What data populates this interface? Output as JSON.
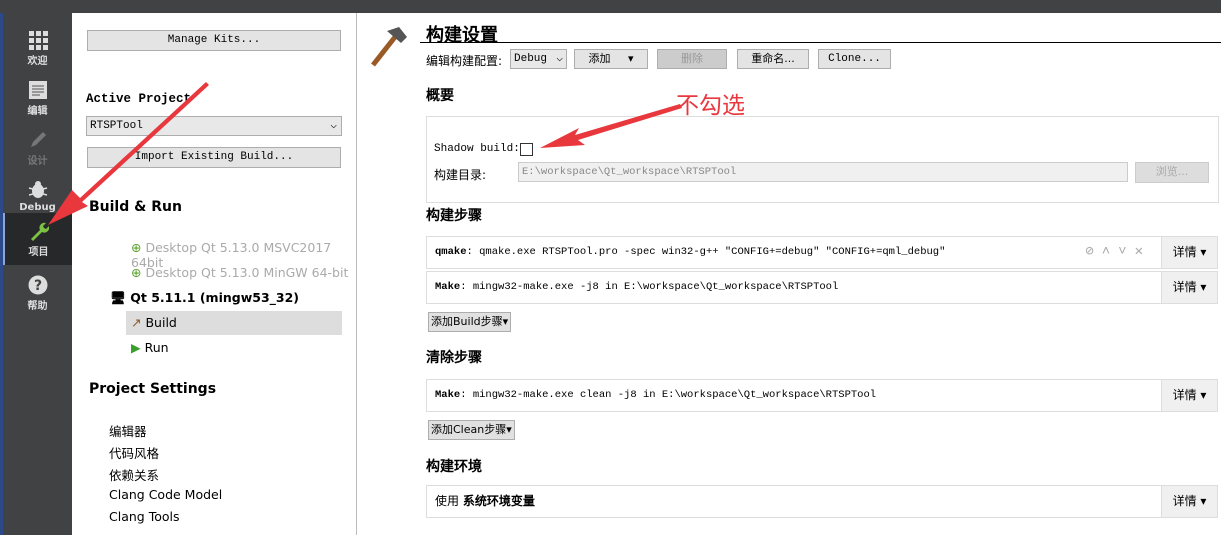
{
  "nav": [
    {
      "label": "欢迎",
      "icon": "grid-icon"
    },
    {
      "label": "编辑",
      "icon": "document-icon"
    },
    {
      "label": "设计",
      "icon": "pencil-icon"
    },
    {
      "label": "Debug",
      "icon": "bug-icon"
    },
    {
      "label": "项目",
      "icon": "wrench-icon",
      "active": true
    },
    {
      "label": "帮助",
      "icon": "help-icon"
    }
  ],
  "left": {
    "manage_kits": "Manage Kits...",
    "active_project_label": "Active Project",
    "active_project": "RTSPTool",
    "import_build": "Import Existing Build...",
    "build_run": "Build & Run",
    "kits": [
      "Desktop Qt 5.13.0 MSVC2017 64bit",
      "Desktop Qt 5.13.0 MinGW 64-bit"
    ],
    "active_kit": "Qt 5.11.1 (mingw53_32)",
    "build": "Build",
    "run": "Run",
    "project_settings": "Project Settings",
    "settings": [
      "编辑器",
      "代码风格",
      "依赖关系",
      "Clang Code Model",
      "Clang Tools"
    ]
  },
  "right": {
    "title": "构建设置",
    "edit_config_label": "编辑构建配置:",
    "config": "Debug",
    "add": "添加",
    "remove": "删除",
    "rename": "重命名...",
    "clone": "Clone...",
    "overview": "概要",
    "shadow_build_label": "Shadow build:",
    "shadow_build_checked": false,
    "build_dir_label": "构建目录:",
    "build_dir": "E:\\workspace\\Qt_workspace\\RTSPTool",
    "browse": "浏览...",
    "build_steps": "构建步骤",
    "qmake_label": "qmake",
    "qmake_cmd": ": qmake.exe RTSPTool.pro -spec win32-g++ \"CONFIG+=debug\" \"CONFIG+=qml_debug\"",
    "make_label": "Make",
    "make_cmd": ": mingw32-make.exe -j8 in E:\\workspace\\Qt_workspace\\RTSPTool",
    "details": "详情",
    "add_build_step": "添加Build步骤",
    "clean_steps": "清除步骤",
    "clean_cmd": ": mingw32-make.exe clean -j8 in E:\\workspace\\Qt_workspace\\RTSPTool",
    "add_clean_step": "添加Clean步骤",
    "build_env": "构建环境",
    "use_label": "使用",
    "env_name": "系统环境变量"
  },
  "annotation": {
    "text": "不勾选",
    "color": "#e8383d"
  }
}
